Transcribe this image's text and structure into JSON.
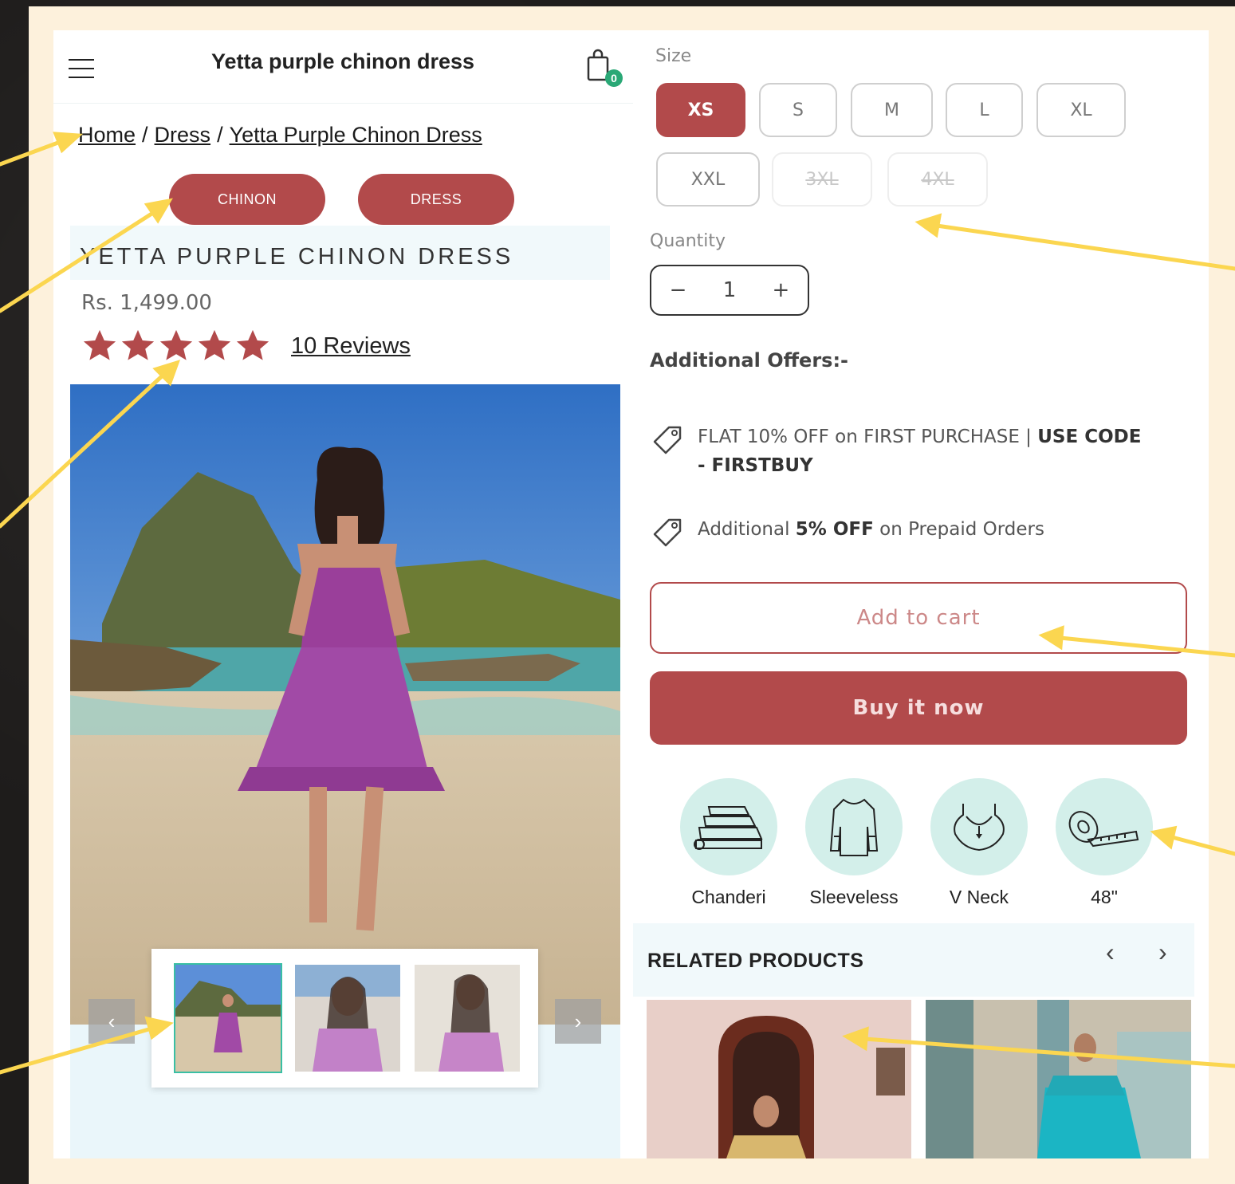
{
  "header": {
    "title": "Yetta purple chinon dress",
    "cart_count": "0"
  },
  "breadcrumb": {
    "home": "Home",
    "sep1": "/",
    "category": "Dress",
    "sep2": "/",
    "current": "Yetta Purple Chinon Dress"
  },
  "tags": [
    "CHINON",
    "DRESS"
  ],
  "product": {
    "title": "YETTA PURPLE CHINON DRESS",
    "price": "Rs. 1,499.00",
    "rating": 5,
    "reviews_label": "10 Reviews"
  },
  "gallery": {
    "prev_label": "‹",
    "next_label": "›",
    "thumbnail_count": 3,
    "active_index": 0
  },
  "size": {
    "label": "Size",
    "options": [
      "XS",
      "S",
      "M",
      "L",
      "XL",
      "XXL",
      "3XL",
      "4XL"
    ],
    "selected": "XS",
    "unavailable": [
      "3XL",
      "4XL"
    ]
  },
  "quantity": {
    "label": "Quantity",
    "value": "1",
    "minus": "−",
    "plus": "+"
  },
  "offers": {
    "title": "Additional Offers:-",
    "offer1_text": "FLAT 10% OFF on FIRST PURCHASE | ",
    "offer1_bold": "USE CODE - FIRSTBUY",
    "offer2_pre": "Additional ",
    "offer2_bold": "5% OFF",
    "offer2_post": " on Prepaid Orders"
  },
  "actions": {
    "add_to_cart": "Add to cart",
    "buy_now": "Buy it now"
  },
  "features": [
    {
      "label": "Chanderi",
      "icon": "fabric-stack-icon"
    },
    {
      "label": "Sleeveless",
      "icon": "sleeveless-top-icon"
    },
    {
      "label": "V Neck",
      "icon": "v-neck-icon"
    },
    {
      "label": "48\"",
      "icon": "measuring-tape-icon"
    }
  ],
  "related": {
    "title": "RELATED PRODUCTS",
    "prev": "‹",
    "next": "›"
  },
  "colors": {
    "brand": "#b24a4b",
    "feature_bg": "#d3efea",
    "frame": "#fdf1dc",
    "annotation": "#fbd650"
  }
}
